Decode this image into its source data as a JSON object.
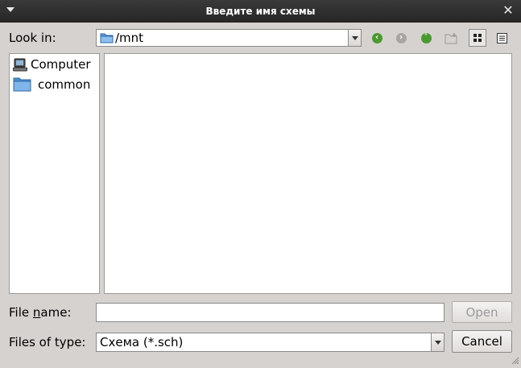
{
  "window": {
    "title": "Введите имя схемы"
  },
  "look_in": {
    "label": "Look in:",
    "path": "/mnt"
  },
  "toolbar": {
    "back": "back-icon",
    "forward": "forward-icon",
    "up": "up-icon",
    "new_folder": "new-folder-icon",
    "list_view": "list-view-icon",
    "detail_view": "detail-view-icon"
  },
  "sidebar": {
    "items": [
      {
        "label": "Computer",
        "icon": "computer-icon"
      },
      {
        "label": "common",
        "icon": "folder-icon"
      }
    ]
  },
  "file_name": {
    "label": "File name:",
    "value": "",
    "label_prefix": "File ",
    "label_mnemonic": "n",
    "label_suffix": "ame:"
  },
  "file_type": {
    "label": "Files of type:",
    "value": "Схема (*.sch)"
  },
  "buttons": {
    "open": "Open",
    "cancel": "Cancel"
  },
  "colors": {
    "titlebar": "#2e2e2e",
    "nav_green": "#4a9a2e",
    "folder": "#5b9bd5"
  }
}
